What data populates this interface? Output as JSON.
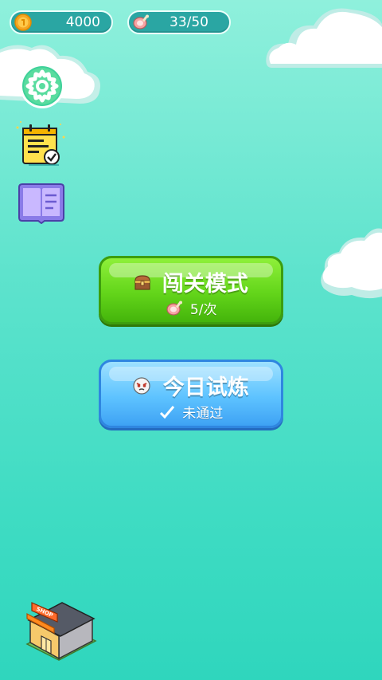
{
  "hud": {
    "coins": "4000",
    "meat": "33/50",
    "coin_icon": "coin-icon",
    "meat_icon": "meat-icon"
  },
  "sidebar": [
    {
      "name": "settings",
      "icon": "gear-icon"
    },
    {
      "name": "daily-tasks",
      "icon": "checklist-icon"
    },
    {
      "name": "guide-book",
      "icon": "book-icon"
    }
  ],
  "main": {
    "stage_mode": {
      "title": "闯关模式",
      "cost": "5/次",
      "icon": "treasure-chest-icon",
      "cost_icon": "meat-icon"
    },
    "daily_trial": {
      "title": "今日试炼",
      "status": "未通过",
      "icon": "boss-face-icon",
      "status_icon": "check-icon"
    }
  },
  "shop": {
    "sign": "SHOP",
    "icon": "shop-building-icon"
  },
  "colors": {
    "background_top": "#8ff0dc",
    "background_bottom": "#2fd6bd",
    "pill": "#2aa6a3",
    "green_button": "#63d51a",
    "blue_button": "#5ec3ff"
  }
}
